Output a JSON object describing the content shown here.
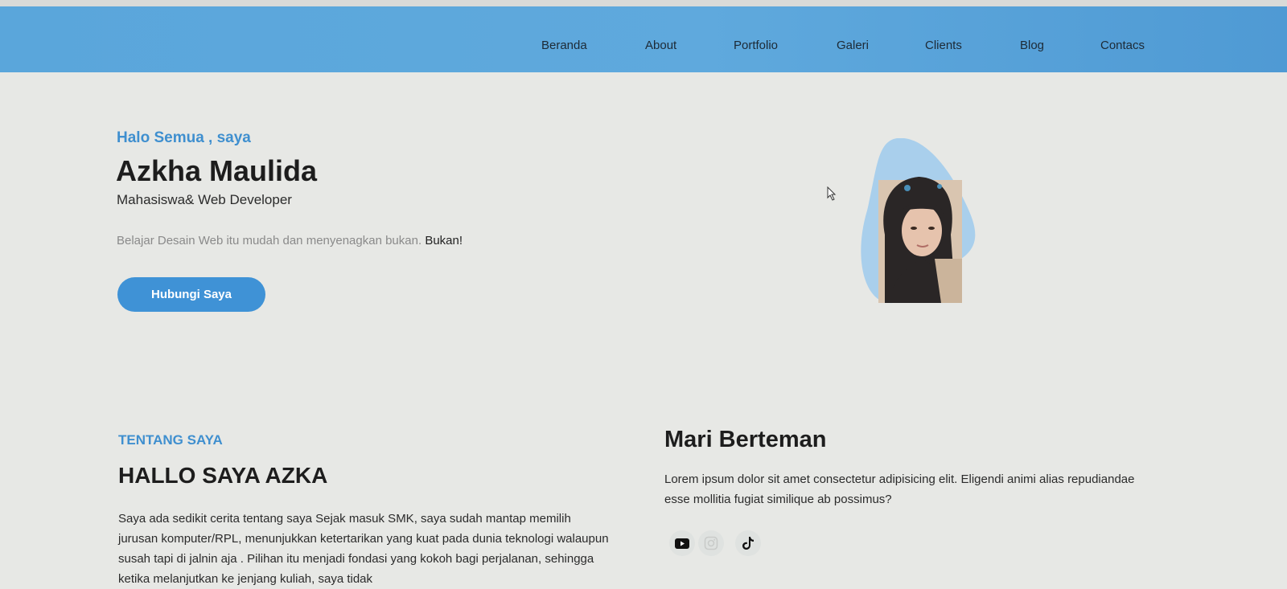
{
  "nav": {
    "items": [
      "Beranda",
      "About",
      "Portfolio",
      "Galeri",
      "Clients",
      "Blog",
      "Contacs"
    ]
  },
  "hero": {
    "greeting": "Halo Semua , saya",
    "name": "Azkha Maulida",
    "role": "Mahasiswa& Web Developer",
    "tagline": "Belajar Desain Web itu mudah dan menyenagkan bukan.",
    "tagline_strong": "Bukan!",
    "cta_label": "Hubungi Saya"
  },
  "about": {
    "eyebrow": "TENTANG SAYA",
    "title": "HALLO SAYA AZKA",
    "body": "Saya ada sedikit cerita tentang saya Sejak masuk SMK, saya sudah mantap memilih jurusan komputer/RPL, menunjukkan ketertarikan yang kuat pada dunia teknologi walaupun susah tapi di jalnin aja . Pilihan itu menjadi fondasi yang kokoh bagi perjalanan, sehingga ketika melanjutkan ke jenjang kuliah, saya tidak"
  },
  "social": {
    "title": "Mari Berteman",
    "body": "Lorem ipsum dolor sit amet consectetur adipisicing elit. Eligendi animi alias repudiandae esse mollitia fugiat similique ab possimus?",
    "icons": [
      "youtube-icon",
      "instagram-icon",
      "tiktok-icon"
    ]
  },
  "colors": {
    "navbar": "#5aa6db",
    "accent": "#3f8fcf",
    "button": "#3f92d6",
    "background": "#e7e8e5"
  }
}
